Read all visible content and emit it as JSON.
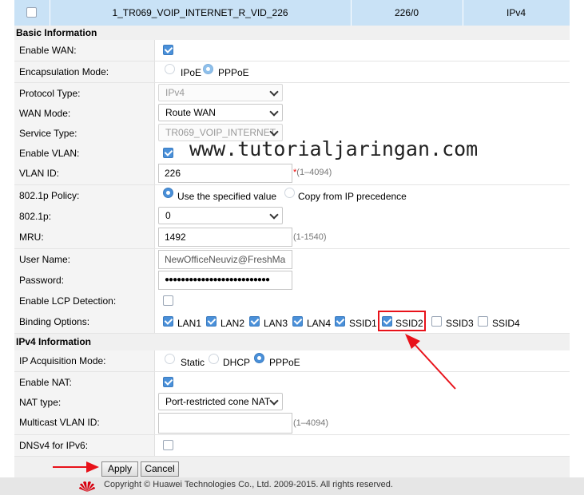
{
  "top_row": {
    "name": "1_TR069_VOIP_INTERNET_R_VID_226",
    "vlan": "226/0",
    "ip": "IPv4"
  },
  "basic_section_title": "Basic Information",
  "fields": {
    "enable_wan": "Enable WAN:",
    "encap_mode": "Encapsulation Mode:",
    "encap_opt_ipoe": "IPoE",
    "encap_opt_pppoe": "PPPoE",
    "protocol_type": "Protocol Type:",
    "protocol_value": "IPv4",
    "wan_mode": "WAN Mode:",
    "wan_mode_value": "Route WAN",
    "service_type": "Service Type:",
    "service_value": "TR069_VOIP_INTERNET",
    "enable_vlan": "Enable VLAN:",
    "vlan_id": "VLAN ID:",
    "vlan_id_value": "226",
    "vlan_id_hint": "(1–4094)",
    "policy": "802.1p Policy:",
    "policy_opt1": "Use the specified value",
    "policy_opt2": "Copy from IP precedence",
    "p8021": "802.1p:",
    "p8021_value": "0",
    "mru": "MRU:",
    "mru_value": "1492",
    "mru_hint": "(1-1540)",
    "username": "User Name:",
    "username_value": "NewOfficeNeuviz@FreshMa",
    "password": "Password:",
    "password_value": "●●●●●●●●●●●●●●●●●●●●●●●●●●",
    "lcp": "Enable LCP Detection:",
    "binding": "Binding Options:",
    "binding_items": [
      "LAN1",
      "LAN2",
      "LAN3",
      "LAN4",
      "SSID1",
      "SSID2",
      "SSID3",
      "SSID4"
    ]
  },
  "ipv4_section_title": "IPv4 Information",
  "ipv4": {
    "acq_mode": "IP Acquisition Mode:",
    "acq_static": "Static",
    "acq_dhcp": "DHCP",
    "acq_pppoe": "PPPoE",
    "enable_nat": "Enable NAT:",
    "nat_type": "NAT type:",
    "nat_value": "Port-restricted cone NAT",
    "mcast_vlan": "Multicast VLAN ID:",
    "mcast_hint": "(1–4094)",
    "dnsv4": "DNSv4 for IPv6:"
  },
  "buttons": {
    "apply": "Apply",
    "cancel": "Cancel"
  },
  "footer": "Copyright © Huawei Technologies Co., Ltd. 2009-2015. All rights reserved.",
  "watermark": "www.tutorialjaringan.com",
  "colors": {
    "checked": "#4a90d9",
    "annotation": "#e8121a",
    "header_blue": "#c9e2f6"
  }
}
